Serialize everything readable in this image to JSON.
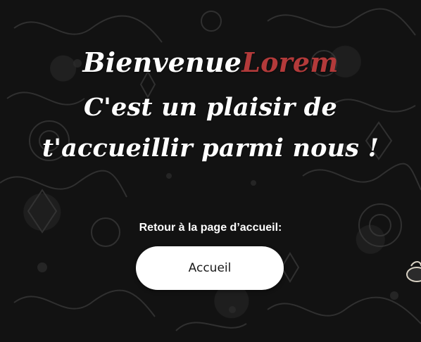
{
  "welcome": {
    "greeting": "Bienvenue",
    "name": "Lorem",
    "line2": "C'est un plaisir de",
    "line3": "t'accueillir parmi nous !"
  },
  "nav": {
    "retour_label": "Retour à la page d’accueil:",
    "accueil_button": "Accueil"
  },
  "colors": {
    "background": "#121212",
    "name_accent": "#b33a3a",
    "button_bg": "#ffffff",
    "text": "#ffffff"
  },
  "icons": {
    "background": "damask-pattern-icon",
    "edge": "antique-phone-icon"
  }
}
